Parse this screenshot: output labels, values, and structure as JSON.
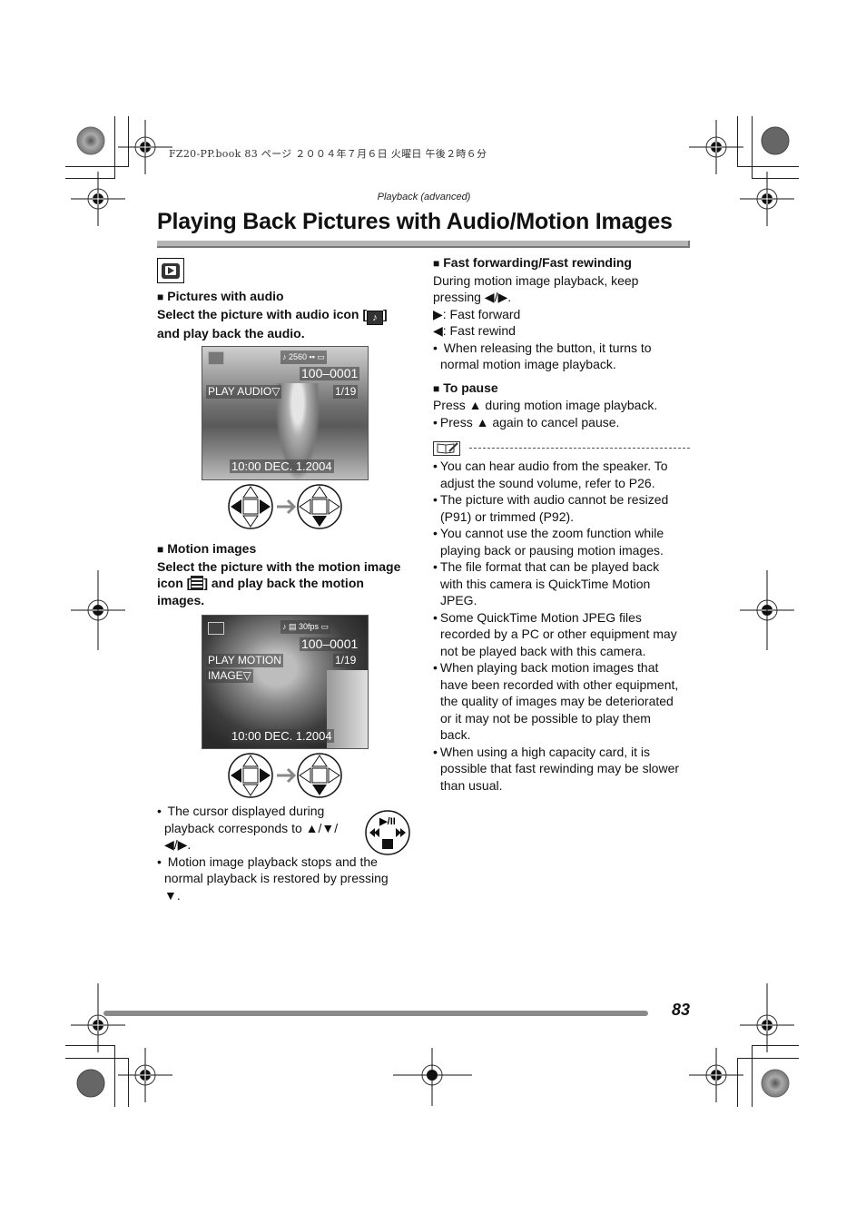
{
  "slug": "FZ20-PP.book  83 ページ  ２００４年７月６日  火曜日  午後２時６分",
  "section_label": "Playback (advanced)",
  "title": "Playing Back Pictures with Audio/Motion Images",
  "page_number": "83",
  "icons": {
    "mode": "playback-mode-icon",
    "audio": "audio-icon",
    "motion": "motion-image-icon",
    "note": "note-icon"
  },
  "left": {
    "audio_heading": "Pictures with audio",
    "audio_instruction_1": "Select the picture with audio icon [",
    "audio_instruction_2": "]",
    "audio_instruction_3": "and play back the audio.",
    "screen1": {
      "size": "2560",
      "file": "100–0001",
      "label": "PLAY AUDIO▽",
      "count": "1/19",
      "datetime": "10:00  DEC. 1.2004"
    },
    "motion_heading": "Motion images",
    "motion_instruction_1": "Select the picture with the motion image",
    "motion_instruction_2": "icon [",
    "motion_instruction_3": "] and play back the motion",
    "motion_instruction_4": "images.",
    "screen2": {
      "fps": "30fps",
      "file": "100–0001",
      "label_1": "PLAY MOTION",
      "label_2": "IMAGE▽",
      "count": "1/19",
      "datetime": "10:00  DEC. 1.2004"
    },
    "bullets": [
      [
        "The cursor displayed during",
        "playback corresponds to ▲/▼/",
        "◀/▶."
      ],
      [
        "Motion image playback stops and the",
        "normal playback is restored by pressing",
        "▼."
      ]
    ],
    "cursor_icon_label": "▶/II"
  },
  "right": {
    "ff_heading": "Fast forwarding/Fast rewinding",
    "ff_lines": [
      "During motion image playback, keep",
      "pressing ◀/▶.",
      "▶:  Fast forward",
      "◀:  Fast rewind"
    ],
    "ff_bullet": [
      "When releasing the button, it turns to",
      "normal motion image playback."
    ],
    "pause_heading": "To pause",
    "pause_line": "Press ▲ during motion image playback.",
    "pause_bullet": "Press ▲ again to cancel pause.",
    "notes": [
      [
        "You can hear audio from the speaker. To",
        "adjust the sound volume, refer to P26."
      ],
      [
        "The picture with audio cannot be resized",
        "(P91) or trimmed (P92)."
      ],
      [
        "You cannot use the zoom function while",
        "playing back or pausing motion images."
      ],
      [
        "The file format that can be played back",
        "with this camera is QuickTime Motion",
        "JPEG."
      ],
      [
        "Some QuickTime Motion JPEG files",
        "recorded by a PC or other equipment may",
        "not be played back with this camera."
      ],
      [
        "When playing back motion images that",
        "have been recorded with other equipment,",
        "the quality of images may be deteriorated",
        "or it may not be possible to play them",
        "back."
      ],
      [
        "When using a high capacity card, it is",
        "possible that fast rewinding may be slower",
        "than usual."
      ]
    ]
  }
}
